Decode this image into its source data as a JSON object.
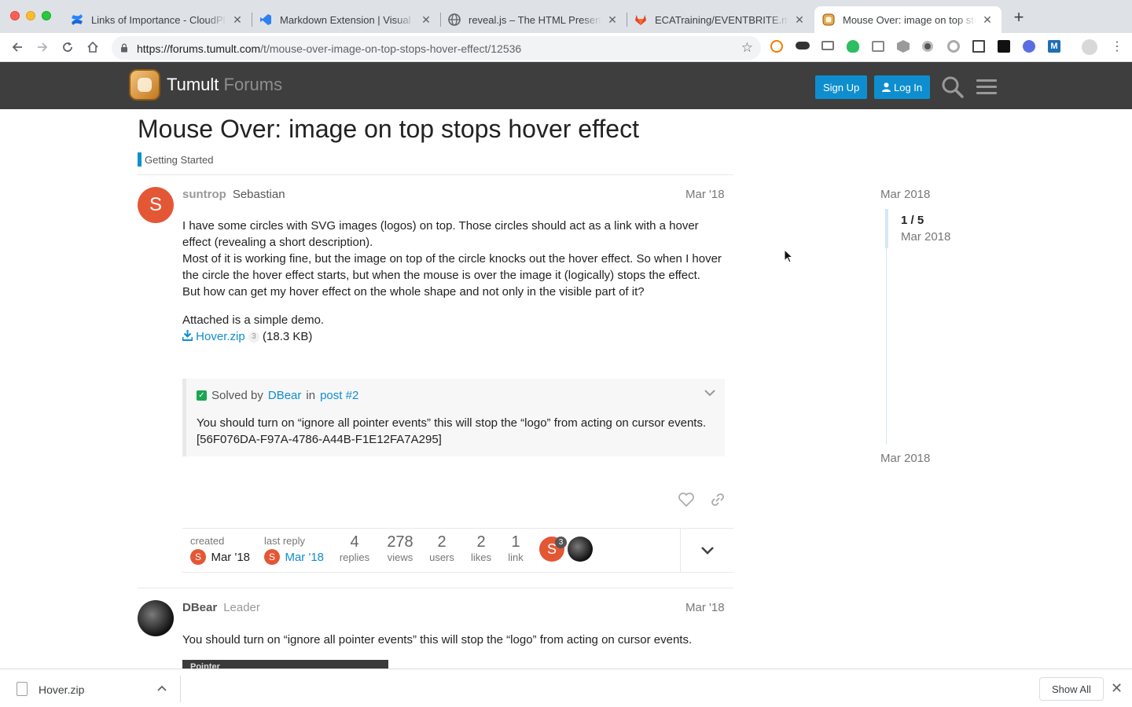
{
  "browser": {
    "tabs": [
      {
        "title": "Links of Importance - CloudPla",
        "icon": "confluence-icon",
        "color": "#1868db"
      },
      {
        "title": "Markdown Extension | Visual S",
        "icon": "vscode-icon",
        "color": "#2f80ed"
      },
      {
        "title": "reveal.js – The HTML Presenta",
        "icon": "globe-icon",
        "color": "#5f6368"
      },
      {
        "title": "ECATraining/EVENTBRITE.md ·",
        "icon": "gitlab-icon",
        "color": "#e24329"
      },
      {
        "title": "Mouse Over: image on top stop",
        "icon": "tumult-icon",
        "color": "#c2781f",
        "active": true
      }
    ],
    "url_host": "https://forums.tumult.com",
    "url_path": "/t/mouse-over-image-on-top-stops-hover-effect/12536"
  },
  "site": {
    "logo_main": "Tumult",
    "logo_sub": "Forums",
    "signup_label": "Sign Up",
    "login_label": "Log In"
  },
  "topic": {
    "title": "Mouse Over: image on top stops hover effect",
    "category": "Getting Started",
    "category_color": "#0e8ecf"
  },
  "post1": {
    "avatar_letter": "S",
    "username": "suntrop",
    "fullname": "Sebastian",
    "date": "Mar '18",
    "paragraph1_line1": "I have some circles with SVG images (logos) on top. Those circles should act as a link with a hover effect (revealing a short description).",
    "paragraph1_line2": "Most of it is working fine, but the image on top of the circle knocks out the hover effect. So when I hover the circle the hover effect starts, but when the mouse is over the image it (logically) stops the effect.",
    "paragraph1_line3": "But how can get my hover effect on the whole shape and not only in the visible part of it?",
    "paragraph2": "Attached is a simple demo.",
    "attachment_name": "Hover.zip",
    "attachment_clicks": "3",
    "attachment_size": "(18.3 KB)",
    "solved_prefix": "Solved by",
    "solved_user": "DBear",
    "solved_in": "in",
    "solved_post": "post #2",
    "solved_text": "You should turn on “ignore all pointer events” this will stop the “logo” from acting on cursor events. [56F076DA-F97A-4786-A44B-F1E12FA7A295]"
  },
  "topic_map": {
    "created_label": "created",
    "created_date": "Mar '18",
    "last_reply_label": "last reply",
    "last_reply_date": "Mar '18",
    "avatar_letter": "S",
    "replies": "4",
    "replies_label": "replies",
    "views": "278",
    "views_label": "views",
    "users": "2",
    "users_label": "users",
    "likes": "2",
    "likes_label": "likes",
    "links": "1",
    "links_label": "link",
    "participant_count": "3"
  },
  "post2": {
    "username": "DBear",
    "title": "Leader",
    "date": "Mar '18",
    "text": "You should turn on “ignore all pointer events” this will stop the “logo” from acting on cursor events.",
    "image_caption": "Pointer"
  },
  "timeline": {
    "top_date": "Mar 2018",
    "counter": "1 / 5",
    "counter_date": "Mar 2018",
    "bottom_date": "Mar 2018"
  },
  "downloads": {
    "file_name": "Hover.zip",
    "show_all_label": "Show All"
  }
}
